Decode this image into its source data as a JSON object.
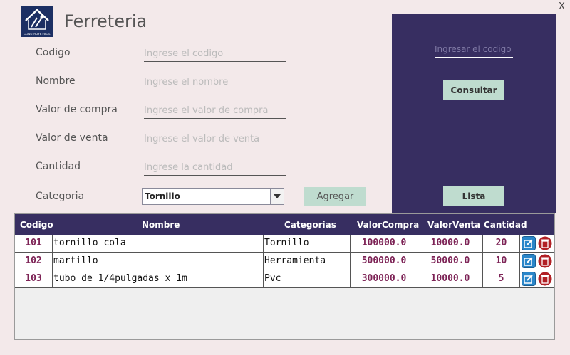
{
  "window": {
    "close_label": "X"
  },
  "app": {
    "title": "Ferreteria",
    "logo_text": "CONSTRUYE FACIL"
  },
  "form": {
    "fields": [
      {
        "label": "Codigo",
        "placeholder": "Ingrese el codigo",
        "value": ""
      },
      {
        "label": "Nombre",
        "placeholder": "Ingrese el nombre",
        "value": ""
      },
      {
        "label": "Valor de compra",
        "placeholder": "Ingrese el valor de compra",
        "value": ""
      },
      {
        "label": "Valor de venta",
        "placeholder": "Ingrese el valor de venta",
        "value": ""
      },
      {
        "label": "Cantidad",
        "placeholder": "Ingrese la cantidad",
        "value": ""
      }
    ],
    "category": {
      "label": "Categoria",
      "selected": "Tornillo"
    },
    "add_button": "Agregar"
  },
  "panel": {
    "search_placeholder": "Ingresar el codigo",
    "consult_button": "Consultar",
    "list_button": "Lista"
  },
  "table": {
    "headers": [
      "Codigo",
      "Nombre",
      "Categorias",
      "ValorCompra",
      "ValorVenta",
      "Cantidad"
    ],
    "rows": [
      {
        "code": "101",
        "name": "tornillo cola",
        "category": "Tornillo",
        "buy": "100000.0",
        "sell": "10000.0",
        "qty": "20"
      },
      {
        "code": "102",
        "name": "martillo",
        "category": "Herramienta",
        "buy": "500000.0",
        "sell": "50000.0",
        "qty": "10"
      },
      {
        "code": "103",
        "name": "tubo de 1/4pulgadas x 1m",
        "category": "Pvc",
        "buy": "300000.0",
        "sell": "10000.0",
        "qty": "5"
      }
    ]
  },
  "icons": {
    "edit": "edit-icon",
    "delete": "trash-icon"
  },
  "colors": {
    "background": "#f3e9ea",
    "panel": "#372e61",
    "button": "#bfdccf",
    "value_text": "#7d2356",
    "edit_icon": "#2a86c9",
    "delete_icon": "#b11f24"
  }
}
